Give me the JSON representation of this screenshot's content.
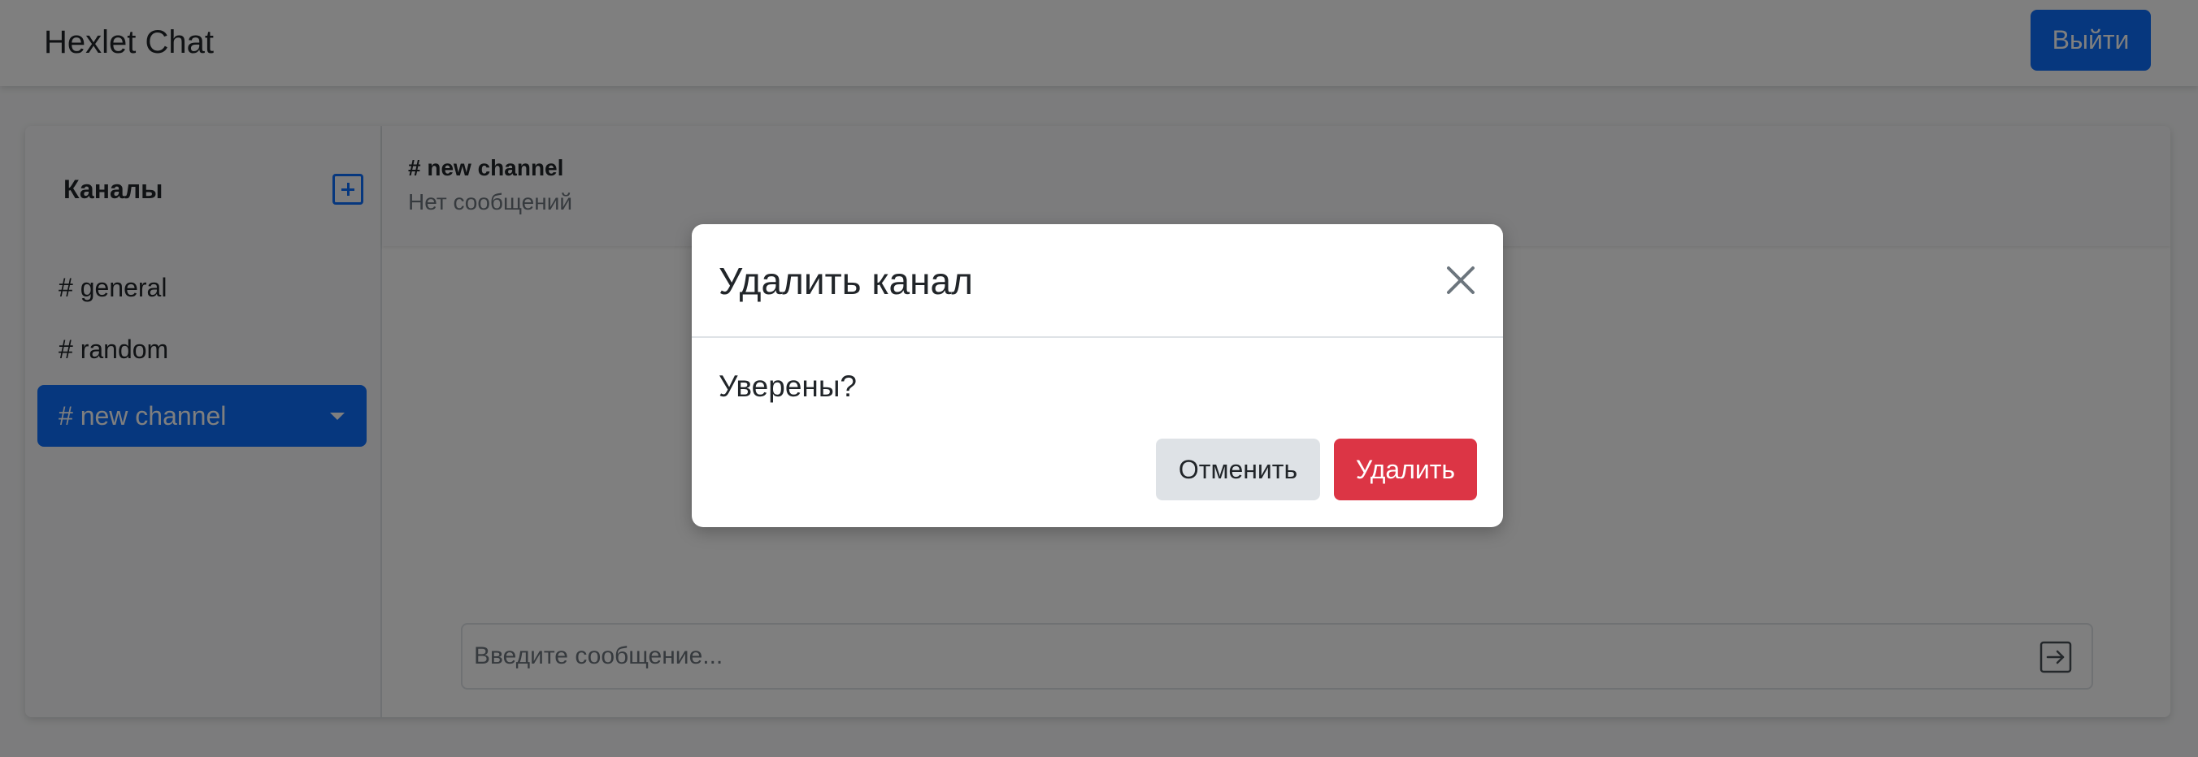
{
  "navbar": {
    "brand": "Hexlet Chat",
    "logout_label": "Выйти"
  },
  "sidebar": {
    "title": "Каналы",
    "add_icon": "plus-square-icon",
    "channels": [
      {
        "label": "# general",
        "active": false
      },
      {
        "label": "# random",
        "active": false
      },
      {
        "label": "# new channel",
        "active": true,
        "has_dropdown": true
      }
    ]
  },
  "chat": {
    "channel_name": "# new channel",
    "messages_count": "Нет сообщений",
    "input_placeholder": "Введите сообщение...",
    "send_icon": "arrow-right-square-icon"
  },
  "modal": {
    "title": "Удалить канал",
    "body": "Уверены?",
    "cancel_label": "Отменить",
    "delete_label": "Удалить",
    "close_icon": "close-icon"
  },
  "colors": {
    "primary": "#0d6efd",
    "danger": "#dc3545",
    "secondary_bg": "#dee2e6",
    "backdrop": "rgba(0,0,0,0.5)"
  }
}
